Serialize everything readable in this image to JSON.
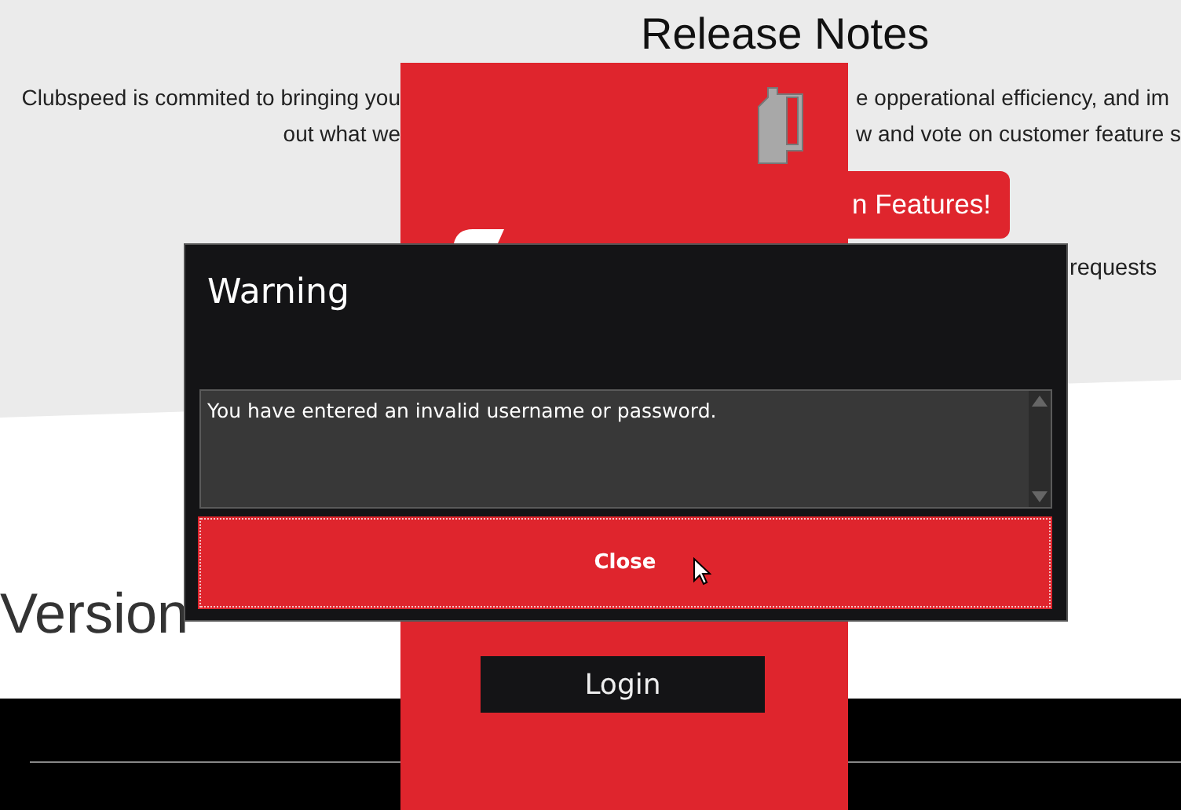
{
  "page": {
    "heading": "Release Notes",
    "intro_fragments": [
      "Clubspeed is commited to bringing you",
      "e opperational efficiency, and im",
      "out what we",
      "w and vote on customer feature s"
    ],
    "features_button": "n Features!",
    "requests_fragment": "requests",
    "version_heading": "Version"
  },
  "login_panel": {
    "login_button": "Login"
  },
  "dialog": {
    "title": "Warning",
    "message": "You have entered an invalid username or password.",
    "close_button": "Close"
  }
}
